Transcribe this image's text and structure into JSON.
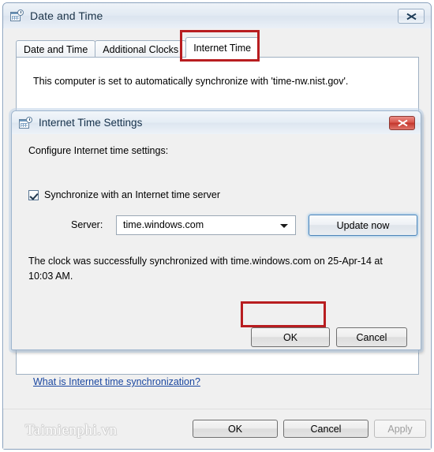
{
  "outer_window": {
    "title": "Date and Time",
    "icon": "calendar-clock-icon",
    "close_label": "Close",
    "tabs": [
      {
        "label": "Date and Time",
        "active": false
      },
      {
        "label": "Additional Clocks",
        "active": false
      },
      {
        "label": "Internet Time",
        "active": true
      }
    ],
    "panel_text": "This computer is set to automatically synchronize with 'time-nw.nist.gov'.",
    "help_link": "What is Internet time synchronization?",
    "buttons": {
      "ok": "OK",
      "cancel": "Cancel",
      "apply": "Apply",
      "apply_disabled": true
    }
  },
  "inner_dialog": {
    "title": "Internet Time Settings",
    "icon": "calendar-clock-icon",
    "close_label": "Close",
    "configure_label": "Configure Internet time settings:",
    "sync_checkbox": {
      "label": "Synchronize with an Internet time server",
      "checked": true
    },
    "server_label": "Server:",
    "server_value": "time.windows.com",
    "update_button": "Update now",
    "status_text": "The clock was successfully synchronized with time.windows.com on 25-Apr-14 at 10:03 AM.",
    "buttons": {
      "ok": "OK",
      "cancel": "Cancel"
    }
  },
  "watermark": "Taimienphi.vn",
  "annotations": {
    "accent_color": "#b81d20",
    "highlighted": [
      "Internet Time tab",
      "OK button of Internet Time Settings"
    ]
  }
}
